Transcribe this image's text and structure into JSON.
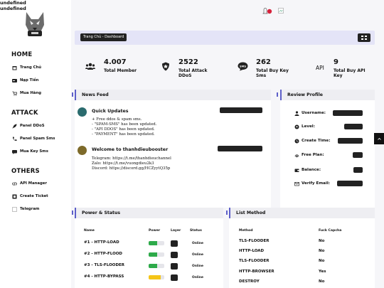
{
  "brand": {
    "line1": "undefined",
    "line2": "undefined"
  },
  "sidebar": {
    "home_title": "HOME",
    "home_items": [
      {
        "label": "Trang Chủ",
        "icon": "calendar-icon"
      },
      {
        "label": "Nạp Tiền",
        "icon": "card-icon"
      },
      {
        "label": "Mua Hàng",
        "icon": "cart-icon"
      }
    ],
    "attack_title": "ATTACK",
    "attack_items": [
      {
        "label": "Panel DDoS",
        "icon": "rocket-icon"
      },
      {
        "label": "Panel Spam Sms",
        "icon": "phone-icon"
      },
      {
        "label": "Mua Key Sms",
        "icon": "sms-icon"
      }
    ],
    "others_title": "OTHERS",
    "others_items": [
      {
        "label": "API Manager",
        "icon": "code-icon"
      },
      {
        "label": "Create Ticket",
        "icon": "ticket-icon"
      },
      {
        "label": "Telegram",
        "icon": "telegram-icon"
      }
    ]
  },
  "topbar": {
    "notification_count": ""
  },
  "breadcrumb": {
    "label": "Trang Chủ - Dashboard"
  },
  "stats": [
    {
      "value": "4.007",
      "label": "Total Member",
      "icon": "users-icon"
    },
    {
      "value": "2522",
      "label_1": "Total Attack",
      "label_2": "DDoS",
      "icon": "shield-icon"
    },
    {
      "value": "262",
      "label_1": "Total Buy Key",
      "label_2": "Sms",
      "icon": "sms-bubble-icon"
    },
    {
      "value": "9",
      "label_1": "Total Buy API",
      "label_2": "Key",
      "icon_text": "API"
    }
  ],
  "news": {
    "title": "News Feed",
    "posts": [
      {
        "title": "Quick Updates",
        "date": "",
        "lines": [
          "+ Free ddos & spam sms.",
          "- \"SPAM-SMS\" has been updated.",
          "- \"API DDOS\" has been updated.",
          "- \"PAYMENT\" has been updated."
        ]
      },
      {
        "title": "Welcome to thanhdieubooster",
        "date": "",
        "lines": [
          "Telegram: https://t.me/thanhdieuchannel",
          "Zalo: https://t.me/vuongdieu2k3",
          "Discord: https://discord.gg/HCZyytQ35p"
        ]
      }
    ]
  },
  "profile": {
    "title": "Review Profile",
    "rows": [
      {
        "label": "Username:",
        "icon": "user-icon"
      },
      {
        "label": "Level:",
        "icon": "level-icon"
      },
      {
        "label": "Create Time:",
        "icon": "clock-icon"
      },
      {
        "label": "Free Plan:",
        "icon": "fingerprint-icon"
      },
      {
        "label": "Balance:",
        "icon": "wallet-icon"
      },
      {
        "label": "Verify Email:",
        "icon": "mail-icon"
      }
    ]
  },
  "power": {
    "title": "Power & Status",
    "headers": [
      "Name",
      "Power",
      "Layer",
      "Status"
    ],
    "rows": [
      {
        "name": "#1 - HTTP-LOAD",
        "power": 0.55,
        "color": "#2eaa4a",
        "status": "Online"
      },
      {
        "name": "#2 - HTTP-FLOOD",
        "power": 0.55,
        "color": "#2eaa4a",
        "status": "Online"
      },
      {
        "name": "#3 - TLS-FLOODER",
        "power": 0.55,
        "color": "#2eaa4a",
        "status": "Online"
      },
      {
        "name": "#4 - HTTP-BYPASS",
        "power": 0.75,
        "color": "#f5c518",
        "status": "Online"
      }
    ]
  },
  "methods": {
    "title": "List Method",
    "headers": [
      "Method",
      "Fuck Capcha"
    ],
    "rows": [
      {
        "method": "TLS-FLOODER",
        "captcha": "No"
      },
      {
        "method": "HTTP-LOAD",
        "captcha": "No"
      },
      {
        "method": "TLS-FLOODER",
        "captcha": "No"
      },
      {
        "method": "HTTP-BROWSER",
        "captcha": "Yes"
      },
      {
        "method": "DESTROY",
        "captcha": "No"
      }
    ]
  },
  "colors": {
    "accent": "#5d5fc9",
    "dark": "#222222",
    "background": "#f6f6f9"
  }
}
